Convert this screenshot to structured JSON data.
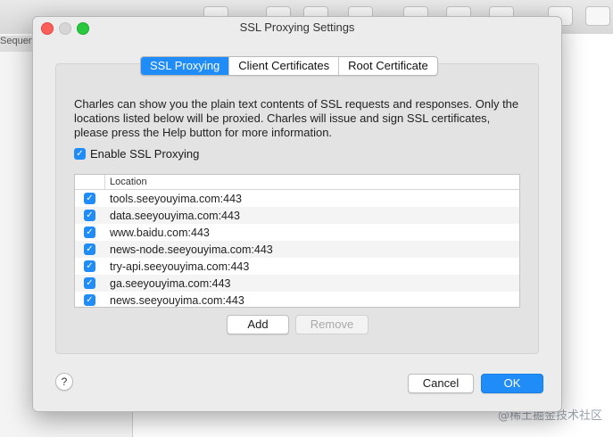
{
  "background": {
    "sequence_tab": "Sequen",
    "watermark": "@稀土掘金技术社区"
  },
  "dialog": {
    "title": "SSL Proxying Settings",
    "tabs": [
      {
        "label": "SSL Proxying",
        "active": true
      },
      {
        "label": "Client Certificates",
        "active": false
      },
      {
        "label": "Root Certificate",
        "active": false
      }
    ],
    "description": "Charles can show you the plain text contents of SSL requests and responses. Only the locations listed below will be proxied. Charles will issue and sign SSL certificates, please press the Help button for more information.",
    "enable_checkbox": {
      "label": "Enable SSL Proxying",
      "checked": true
    },
    "table": {
      "header": "Location",
      "rows": [
        {
          "location": "tools.seeyouyima.com:443",
          "checked": true
        },
        {
          "location": "data.seeyouyima.com:443",
          "checked": true
        },
        {
          "location": "www.baidu.com:443",
          "checked": true
        },
        {
          "location": "news-node.seeyouyima.com:443",
          "checked": true
        },
        {
          "location": "try-api.seeyouyima.com:443",
          "checked": true
        },
        {
          "location": "ga.seeyouyima.com:443",
          "checked": true
        },
        {
          "location": "news.seeyouyima.com:443",
          "checked": true
        }
      ]
    },
    "buttons": {
      "add": "Add",
      "remove": "Remove",
      "help": "?",
      "cancel": "Cancel",
      "ok": "OK"
    }
  },
  "colors": {
    "accent": "#1f8cf8",
    "close": "#fc5f57",
    "maximize": "#2ac83f"
  }
}
